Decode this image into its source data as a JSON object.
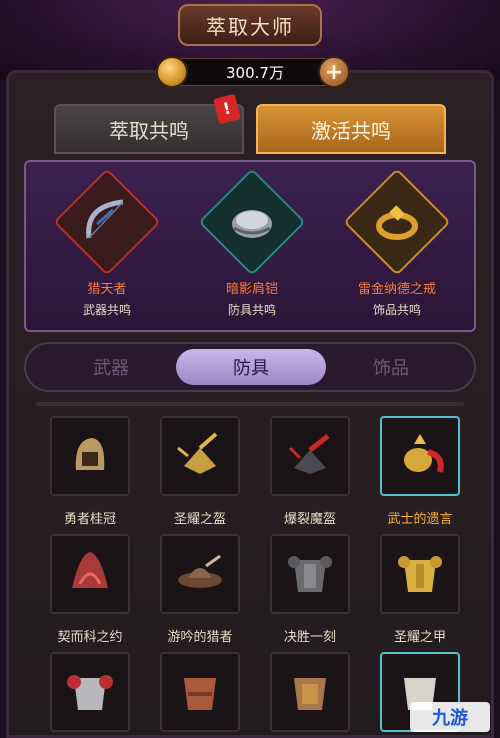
{
  "header": {
    "title": "萃取大师"
  },
  "currency": {
    "amount": "300.7万"
  },
  "tabs": [
    {
      "label": "萃取共鸣",
      "active": false,
      "badge": "!"
    },
    {
      "label": "激活共鸣",
      "active": true
    }
  ],
  "resonance": [
    {
      "name": "猎天者",
      "type": "武器共鸣",
      "icon": "bow-icon"
    },
    {
      "name": "暗影肩铠",
      "type": "防具共鸣",
      "icon": "pauldron-icon"
    },
    {
      "name": "雷金纳德之戒",
      "type": "饰品共鸣",
      "icon": "ring-icon"
    }
  ],
  "segment": {
    "items": [
      "武器",
      "防具",
      "饰品"
    ],
    "selected": "防具"
  },
  "items": [
    {
      "label": "勇者桂冠",
      "icon": "helmet-icon",
      "rare": false
    },
    {
      "label": "圣耀之盔",
      "icon": "horned-helm-icon",
      "rare": false
    },
    {
      "label": "爆裂魔盔",
      "icon": "demon-helm-icon",
      "rare": false
    },
    {
      "label": "武士的遗言",
      "icon": "samurai-helm-icon",
      "rare": true
    },
    {
      "label": "契而科之约",
      "icon": "feather-headdress-icon",
      "rare": false
    },
    {
      "label": "游吟的猎者",
      "icon": "hunter-hat-icon",
      "rare": false
    },
    {
      "label": "决胜一刻",
      "icon": "plate-armor-icon",
      "rare": false
    },
    {
      "label": "圣耀之甲",
      "icon": "gold-armor-icon",
      "rare": false
    },
    {
      "label": "",
      "icon": "chainmail-icon",
      "rare": false
    },
    {
      "label": "",
      "icon": "leather-armor-icon",
      "rare": false
    },
    {
      "label": "",
      "icon": "bronze-armor-icon",
      "rare": false
    },
    {
      "label": "",
      "icon": "silver-armor-icon",
      "rare": true
    }
  ],
  "watermark": "九游"
}
